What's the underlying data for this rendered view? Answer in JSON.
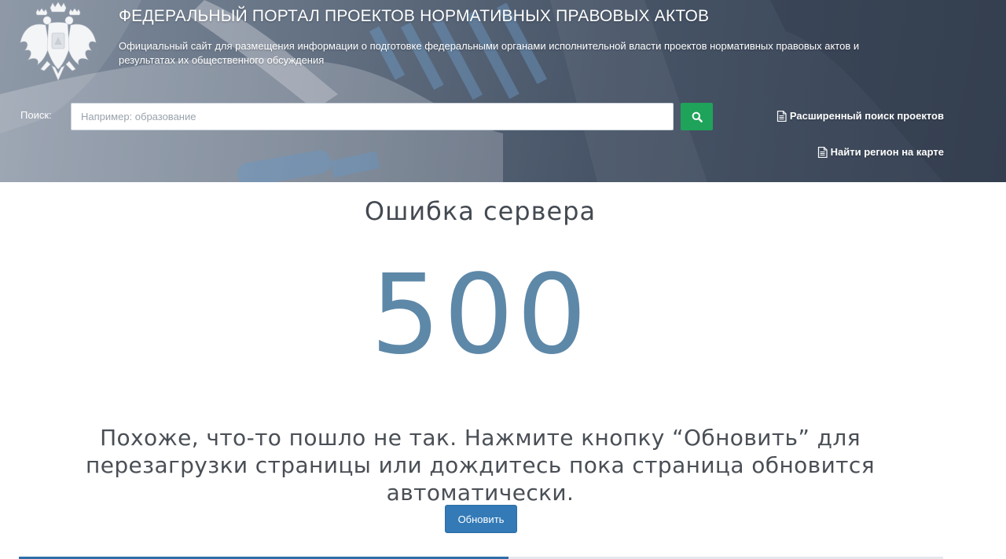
{
  "header": {
    "title": "ФЕДЕРАЛЬНЫЙ ПОРТАЛ ПРОЕКТОВ НОРМАТИВНЫХ ПРАВОВЫХ АКТОВ",
    "subtitle": "Официальный сайт для размещения информации о подготовке федеральными органами исполнительной власти проектов нормативных правовых актов и результатах их общественного обсуждения",
    "search": {
      "label": "Поиск:",
      "placeholder": "Например: образование",
      "value": ""
    },
    "links": {
      "advanced_search": "Расширенный поиск проектов",
      "find_region": "Найти регион на карте"
    }
  },
  "main": {
    "error_title": "Ошибка сервера",
    "error_code": "500",
    "message": "Похоже, что-то пошло не так. Нажмите кнопку “Обновить” для перезагрузки страницы или дождитесь пока страница обновится автоматически.",
    "refresh_button": "Обновить",
    "reload_progress": 0.53
  },
  "colors": {
    "search_button": "#1fa35a",
    "refresh_button": "#337ab7",
    "error_code": "#5e88a8",
    "progress": "#2f6fa8"
  },
  "icons": {
    "search": "magnifier-icon",
    "document": "document-icon",
    "emblem": "coat-of-arms-icon"
  }
}
